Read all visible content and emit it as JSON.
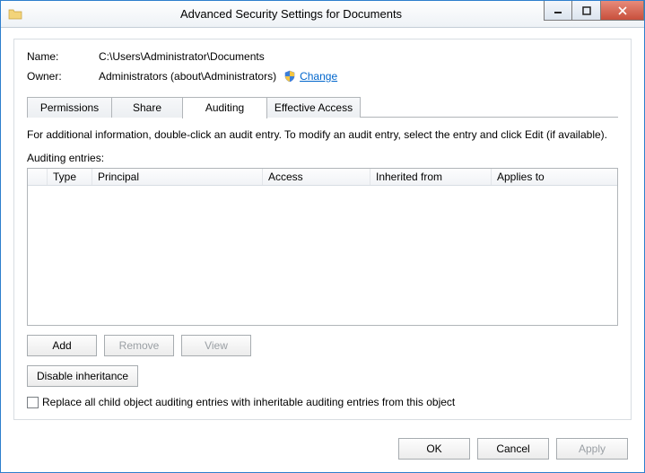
{
  "window": {
    "title": "Advanced Security Settings for Documents"
  },
  "fields": {
    "name_label": "Name:",
    "name_value": "C:\\Users\\Administrator\\Documents",
    "owner_label": "Owner:",
    "owner_value": "Administrators (about\\Administrators)",
    "change_link": "Change"
  },
  "tabs": {
    "permissions": "Permissions",
    "share": "Share",
    "auditing": "Auditing",
    "effective": "Effective Access"
  },
  "instructions": "For additional information, double-click an audit entry. To modify an audit entry, select the entry and click Edit (if available).",
  "list": {
    "label": "Auditing entries:",
    "columns": {
      "icon": "",
      "type": "Type",
      "principal": "Principal",
      "access": "Access",
      "inherited": "Inherited from",
      "applies": "Applies to"
    }
  },
  "buttons": {
    "add": "Add",
    "remove": "Remove",
    "view": "View",
    "disable_inheritance": "Disable inheritance",
    "ok": "OK",
    "cancel": "Cancel",
    "apply": "Apply"
  },
  "checkbox": {
    "replace_label": "Replace all child object auditing entries with inheritable auditing entries from this object",
    "checked": false
  }
}
